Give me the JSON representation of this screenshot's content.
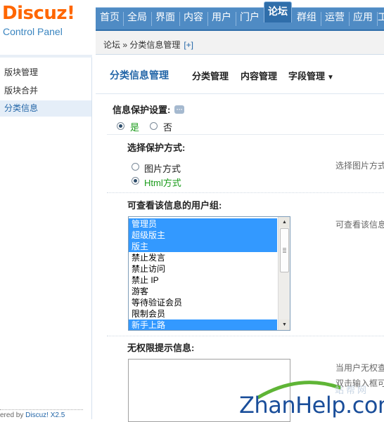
{
  "logo": {
    "main": "Discuz!",
    "sub": "Control Panel"
  },
  "nav": {
    "items": [
      "首页",
      "全局",
      "界面",
      "内容",
      "用户",
      "门户",
      "论坛",
      "群组",
      "运营",
      "应用",
      "工"
    ],
    "active": "论坛"
  },
  "breadcrumb": {
    "text": "论坛 » 分类信息管理",
    "plus": "[+]"
  },
  "sidebar": {
    "items": [
      "版块管理",
      "版块合并",
      "分类信息"
    ],
    "active_index": 2,
    "footer_prefix": "ered by ",
    "footer_link": "Discuz! X2.5"
  },
  "subnav": {
    "title": "分类信息管理",
    "links": [
      "分类管理",
      "内容管理",
      "字段管理"
    ],
    "dropdown_icon": "caret-down-icon"
  },
  "form": {
    "protect_label": "信息保护设置:",
    "protect_options": [
      "是",
      "否"
    ],
    "protect_selected": 0,
    "method_label": "选择保护方式:",
    "method_options": [
      "图片方式",
      "Html方式"
    ],
    "method_selected": 1,
    "method_tip": "选择图片方式",
    "groups_label": "可查看该信息的用户组:",
    "groups_tip": "可查看该信息",
    "groups": [
      {
        "label": "管理员",
        "selected": true
      },
      {
        "label": "超级版主",
        "selected": true
      },
      {
        "label": "版主",
        "selected": true
      },
      {
        "label": "禁止发言",
        "selected": false
      },
      {
        "label": "禁止访问",
        "selected": false
      },
      {
        "label": "禁止 IP",
        "selected": false
      },
      {
        "label": "游客",
        "selected": false
      },
      {
        "label": "等待验证会员",
        "selected": false
      },
      {
        "label": "限制会员",
        "selected": false
      },
      {
        "label": "新手上路",
        "selected": true
      }
    ],
    "noperm_label": "无权限提示信息:",
    "noperm_tip_1": "当用户无权查",
    "noperm_tip_2": "双击输入框可"
  },
  "watermark": {
    "brand": "ZhanHelp.com",
    "cn": "站帮网"
  },
  "colors": {
    "nav_bg": "#4f8bc4",
    "nav_active": "#2f6eaa",
    "logo": "#ff6600",
    "link": "#2366a8",
    "selected": "#3399ff"
  }
}
